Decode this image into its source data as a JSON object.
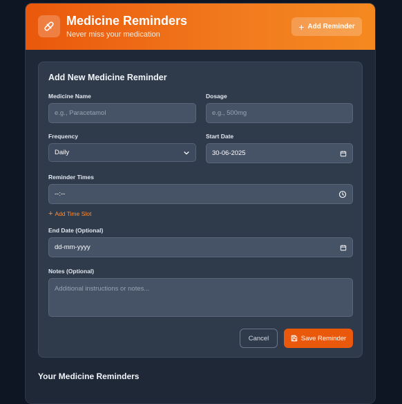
{
  "header": {
    "title": "Medicine Reminders",
    "subtitle": "Never miss your medication",
    "add_button_label": "Add Reminder"
  },
  "form": {
    "title": "Add New Medicine Reminder",
    "medicine_name": {
      "label": "Medicine Name",
      "placeholder": "e.g., Paracetamol",
      "value": ""
    },
    "dosage": {
      "label": "Dosage",
      "placeholder": "e.g., 500mg",
      "value": ""
    },
    "frequency": {
      "label": "Frequency",
      "value": "Daily"
    },
    "start_date": {
      "label": "Start Date",
      "value": "30-06-2025"
    },
    "reminder_times": {
      "label": "Reminder Times",
      "value": "--:--"
    },
    "add_time_slot_label": "Add Time Slot",
    "end_date": {
      "label": "End Date (Optional)",
      "value": "dd-mm-yyyy"
    },
    "notes": {
      "label": "Notes (Optional)",
      "placeholder": "Additional instructions or notes..."
    },
    "cancel_label": "Cancel",
    "save_label": "Save Reminder"
  },
  "list": {
    "title": "Your Medicine Reminders"
  },
  "colors": {
    "accent": "#ea580c",
    "header_gradient_end": "#f5891f",
    "background": "#0f1623",
    "card": "#2f3a4b",
    "link": "#fb923c"
  },
  "icons": {
    "logo": "pill-icon",
    "add": "plus-icon",
    "frequency": "chevron-down-icon",
    "date": "calendar-icon",
    "time": "clock-icon",
    "save": "save-icon"
  }
}
